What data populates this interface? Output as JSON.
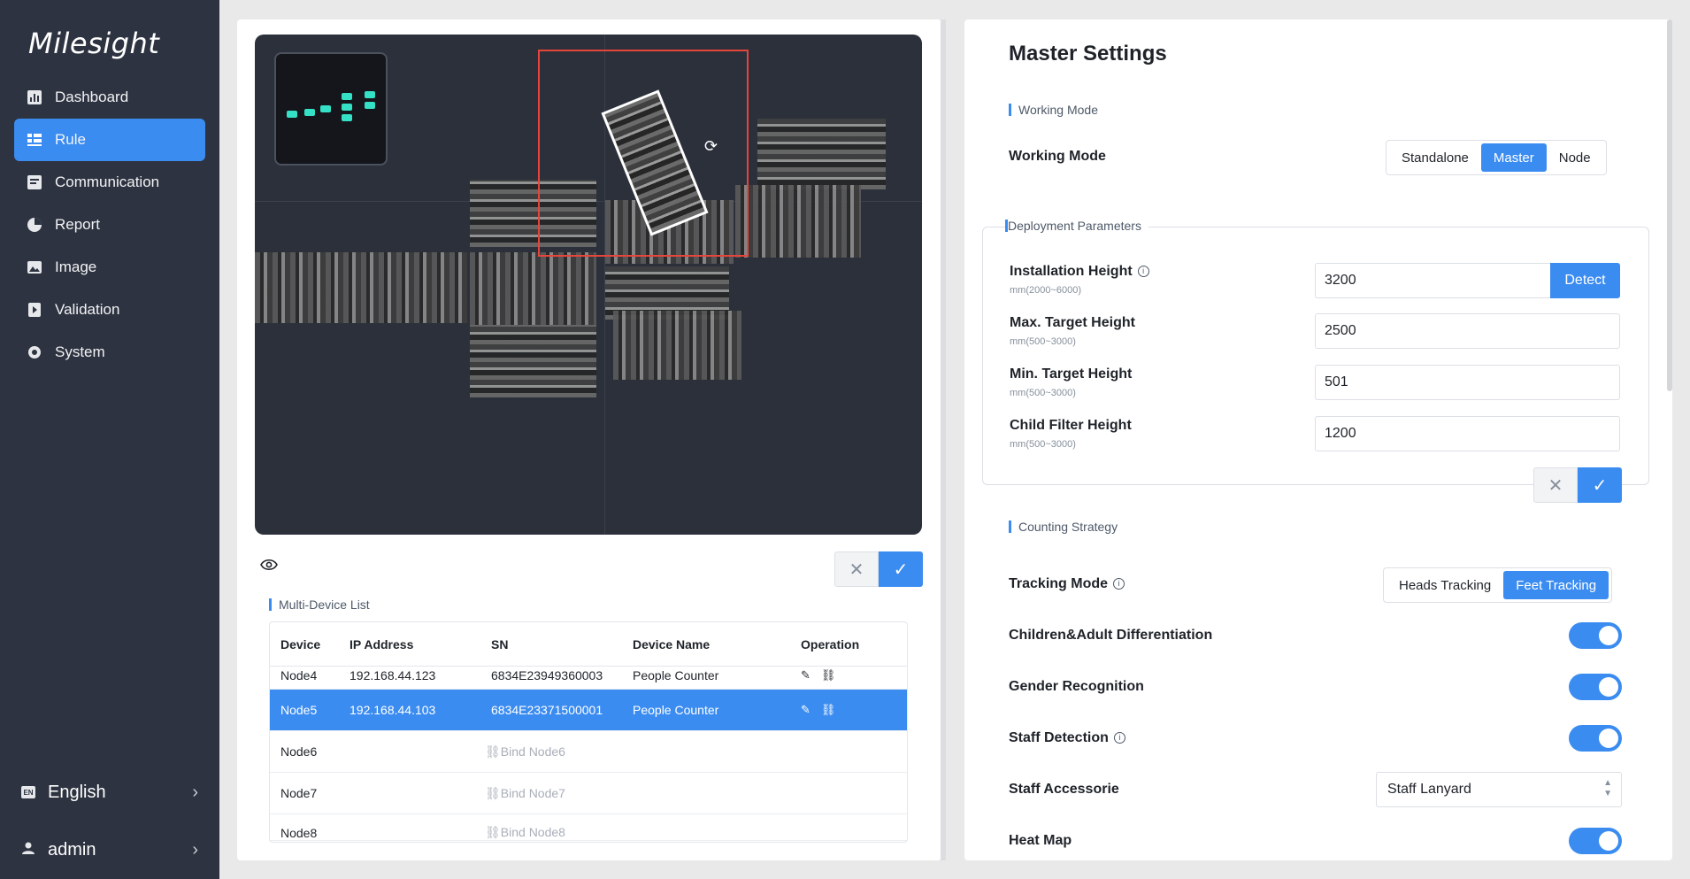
{
  "brand": "Milesight",
  "nav": [
    {
      "label": "Dashboard",
      "icon": "dashboard-icon"
    },
    {
      "label": "Rule",
      "icon": "rule-icon",
      "active": true
    },
    {
      "label": "Communication",
      "icon": "communication-icon"
    },
    {
      "label": "Report",
      "icon": "report-icon"
    },
    {
      "label": "Image",
      "icon": "image-icon"
    },
    {
      "label": "Validation",
      "icon": "validation-icon"
    },
    {
      "label": "System",
      "icon": "system-icon"
    }
  ],
  "language": {
    "label": "English",
    "icon_text": "EN"
  },
  "user": {
    "label": "admin"
  },
  "colors": {
    "accent": "#3b8cf0",
    "sidebar": "#2d3340",
    "selection_box": "#e5453b",
    "minimap_node": "#34e1c6"
  },
  "multi_device": {
    "title": "Multi-Device List",
    "columns": [
      "Device",
      "IP Address",
      "SN",
      "Device Name",
      "Operation"
    ],
    "rows": [
      {
        "device": "Node4",
        "ip": "192.168.44.123",
        "sn": "6834E23949360003",
        "name": "People Counter"
      },
      {
        "device": "Node5",
        "ip": "192.168.44.103",
        "sn": "6834E23371500001",
        "name": "People Counter",
        "selected": true
      },
      {
        "device": "Node6",
        "bind": "Bind Node6"
      },
      {
        "device": "Node7",
        "bind": "Bind Node7"
      },
      {
        "device": "Node8",
        "bind": "Bind Node8"
      }
    ]
  },
  "master": {
    "title": "Master Settings",
    "working_mode_section": "Working Mode",
    "working_mode_label": "Working Mode",
    "working_mode_options": [
      "Standalone",
      "Master",
      "Node"
    ],
    "working_mode_selected": "Master",
    "deployment_section": "Deployment Parameters",
    "fields": [
      {
        "label": "Installation Height",
        "range": "mm(2000~6000)",
        "value": "3200"
      },
      {
        "label": "Max. Target Height",
        "range": "mm(500~3000)",
        "value": "2500"
      },
      {
        "label": "Min. Target Height",
        "range": "mm(500~3000)",
        "value": "501"
      },
      {
        "label": "Child Filter Height",
        "range": "mm(500~3000)",
        "value": "1200"
      }
    ],
    "detect_label": "Detect",
    "counting_section": "Counting Strategy",
    "tracking_mode_label": "Tracking Mode",
    "tracking_options": [
      "Heads Tracking",
      "Feet Tracking"
    ],
    "tracking_selected": "Feet Tracking",
    "children_adult_label": "Children&Adult Differentiation",
    "children_adult_on": true,
    "gender_label": "Gender Recognition",
    "gender_on": true,
    "staff_detection_label": "Staff Detection",
    "staff_detection_on": true,
    "staff_accessorie_label": "Staff Accessorie",
    "staff_accessorie_value": "Staff Lanyard",
    "heat_map_label": "Heat Map",
    "heat_map_on": true
  }
}
